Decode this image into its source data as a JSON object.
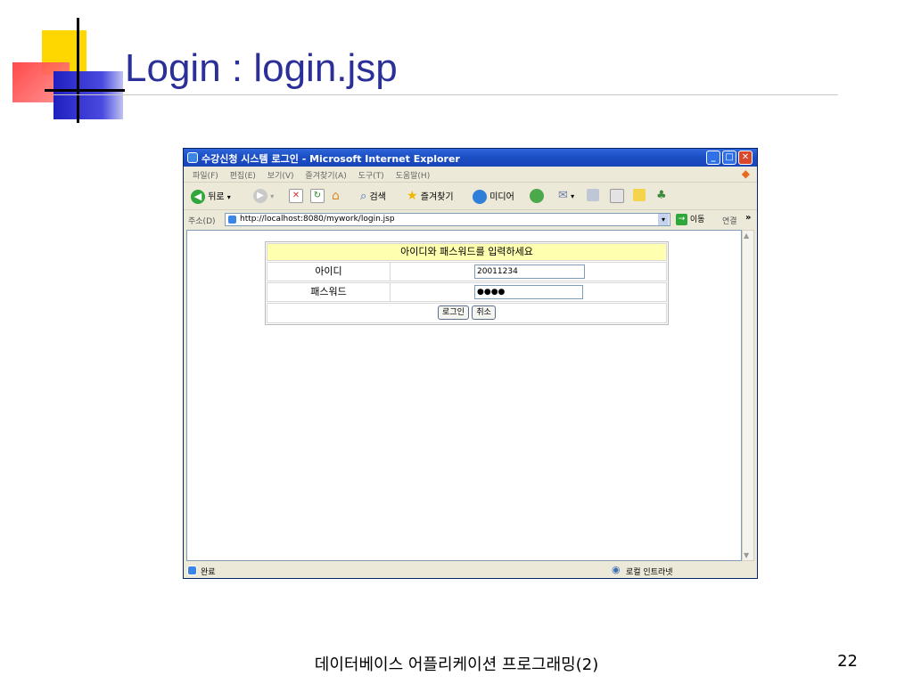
{
  "slide": {
    "title": "Login : login.jsp",
    "footer": "데이터베이스 어플리케이션 프로그래밍(2)",
    "page_number": "22"
  },
  "browser": {
    "window_title": "수강신청 시스템 로그인 - Microsoft Internet Explorer",
    "menu": [
      "파일(F)",
      "편집(E)",
      "보기(V)",
      "즐겨찾기(A)",
      "도구(T)",
      "도움말(H)"
    ],
    "toolbar": {
      "back_label": "뒤로",
      "search_label": "검색",
      "favorites_label": "즐겨찾기",
      "media_label": "미디어"
    },
    "address": {
      "label": "주소(D)",
      "url": "http://localhost:8080/mywork/login.jsp",
      "go_label": "이동",
      "links_label": "연결"
    },
    "status": {
      "text": "완료",
      "zone": "로컬 인트라넷"
    }
  },
  "login_form": {
    "heading": "아이디와 패스워드를 입력하세요",
    "id_label": "아이디",
    "id_value": "20011234",
    "password_label": "패스워드",
    "password_value": "●●●●",
    "login_button": "로그인",
    "cancel_button": "취소"
  },
  "colors": {
    "title": "#2B2F98",
    "ie_titlebar": "#1C4FC4",
    "form_header": "#FFFFB0"
  }
}
